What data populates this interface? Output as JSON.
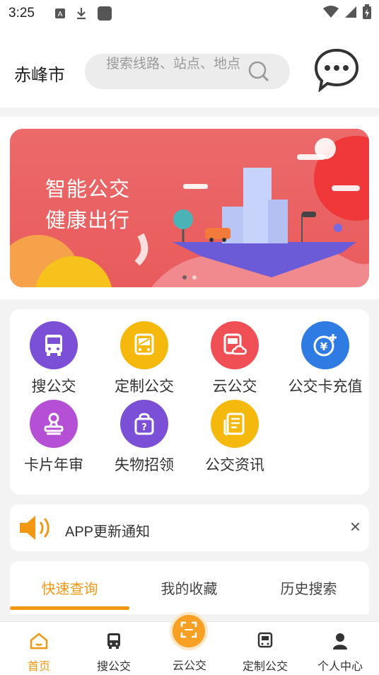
{
  "status_bar": {
    "time": "3:25"
  },
  "header": {
    "city": "赤峰市",
    "search_placeholder": "搜索线路、站点、地点"
  },
  "banner": {
    "line1": "智能公交",
    "line2": "健康出行",
    "page_count": 2,
    "active_page": 1
  },
  "services": [
    {
      "label": "搜公交",
      "icon": "bus-icon",
      "color": "#7b4fd6"
    },
    {
      "label": "定制公交",
      "icon": "custom-bus-icon",
      "color": "#f5b90d"
    },
    {
      "label": "云公交",
      "icon": "cloud-bus-icon",
      "color": "#ef4f55"
    },
    {
      "label": "公交卡充值",
      "icon": "card-recharge-icon",
      "color": "#2f7be4"
    },
    {
      "label": "卡片年审",
      "icon": "stamp-icon",
      "color": "#b44fd6"
    },
    {
      "label": "失物招领",
      "icon": "bag-icon",
      "color": "#7b4fd6"
    },
    {
      "label": "公交资讯",
      "icon": "news-icon",
      "color": "#f5b90d"
    }
  ],
  "notice": {
    "text": "APP更新通知",
    "close": "×"
  },
  "tabs": [
    {
      "label": "快速查询",
      "active": true
    },
    {
      "label": "我的收藏",
      "active": false
    },
    {
      "label": "历史搜索",
      "active": false
    }
  ],
  "bottom_nav": [
    {
      "label": "首页",
      "icon": "home-icon",
      "active": true
    },
    {
      "label": "搜公交",
      "icon": "bus-icon",
      "active": false
    },
    {
      "label": "云公交",
      "icon": "scan-icon",
      "active": false
    },
    {
      "label": "定制公交",
      "icon": "custom-bus-icon",
      "active": false
    },
    {
      "label": "个人中心",
      "icon": "person-icon",
      "active": false
    }
  ],
  "colors": {
    "accent": "#f29712",
    "banner": "#e95b5d"
  }
}
